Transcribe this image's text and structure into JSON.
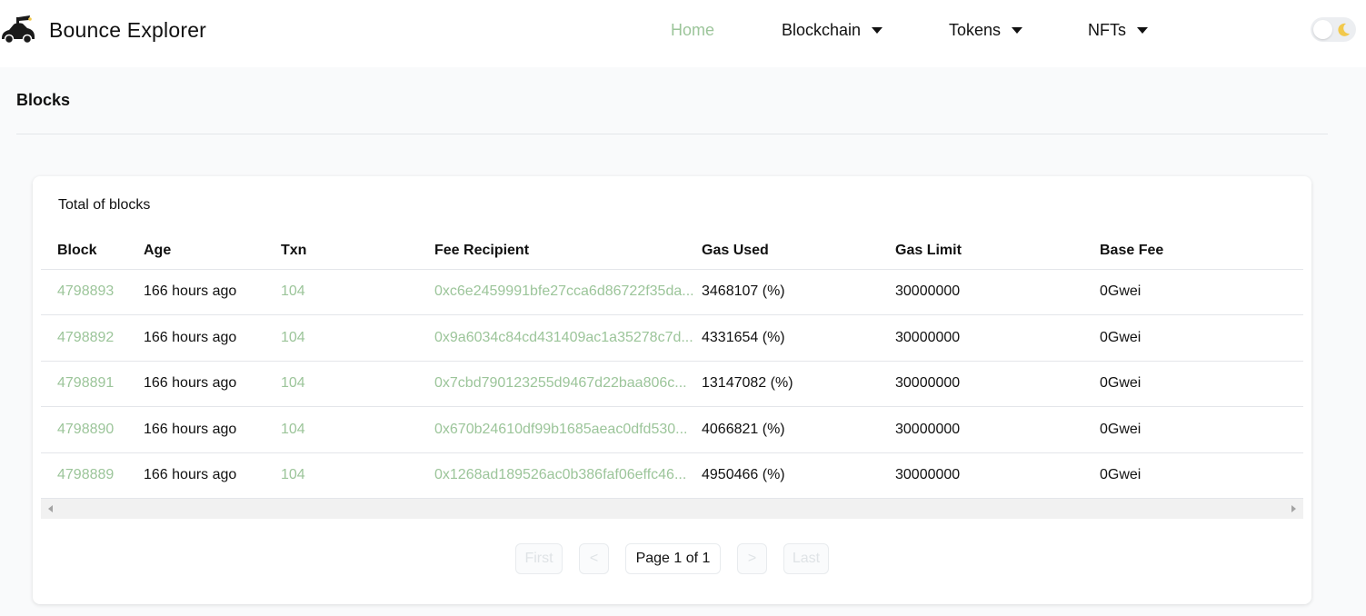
{
  "header": {
    "brand_name": "Bounce Explorer",
    "logo_icon": "car-logo-icon",
    "nav": [
      {
        "label": "Home",
        "active": true
      },
      {
        "label": "Blockchain",
        "dropdown": true
      },
      {
        "label": "Tokens",
        "dropdown": true
      },
      {
        "label": "NFTs",
        "dropdown": true
      }
    ],
    "theme_toggle_icon": "moon-icon"
  },
  "page": {
    "title": "Blocks"
  },
  "card": {
    "caption": "Total of blocks",
    "columns": [
      "Block",
      "Age",
      "Txn",
      "Fee Recipient",
      "Gas Used",
      "Gas Limit",
      "Base Fee"
    ],
    "rows": [
      {
        "block": "4798893",
        "age": "166 hours ago",
        "txn": "104",
        "fee_recipient": "0xc6e2459991bfe27cca6d86722f35da...",
        "gas_used": "3468107 (%)",
        "gas_limit": "30000000",
        "base_fee": "0Gwei"
      },
      {
        "block": "4798892",
        "age": "166 hours ago",
        "txn": "104",
        "fee_recipient": "0x9a6034c84cd431409ac1a35278c7d...",
        "gas_used": "4331654 (%)",
        "gas_limit": "30000000",
        "base_fee": "0Gwei"
      },
      {
        "block": "4798891",
        "age": "166 hours ago",
        "txn": "104",
        "fee_recipient": "0x7cbd790123255d9467d22baa806c...",
        "gas_used": "13147082 (%)",
        "gas_limit": "30000000",
        "base_fee": "0Gwei"
      },
      {
        "block": "4798890",
        "age": "166 hours ago",
        "txn": "104",
        "fee_recipient": "0x670b24610df99b1685aeac0dfd530...",
        "gas_used": "4066821 (%)",
        "gas_limit": "30000000",
        "base_fee": "0Gwei"
      },
      {
        "block": "4798889",
        "age": "166 hours ago",
        "txn": "104",
        "fee_recipient": "0x1268ad189526ac0b386faf06effc46...",
        "gas_used": "4950466 (%)",
        "gas_limit": "30000000",
        "base_fee": "0Gwei"
      }
    ]
  },
  "pagination": {
    "first": "First",
    "prev": "<",
    "info": "Page 1 of 1",
    "next": ">",
    "last": "Last"
  },
  "colors": {
    "accent": "#9cc59a",
    "background": "#f9fafb"
  }
}
